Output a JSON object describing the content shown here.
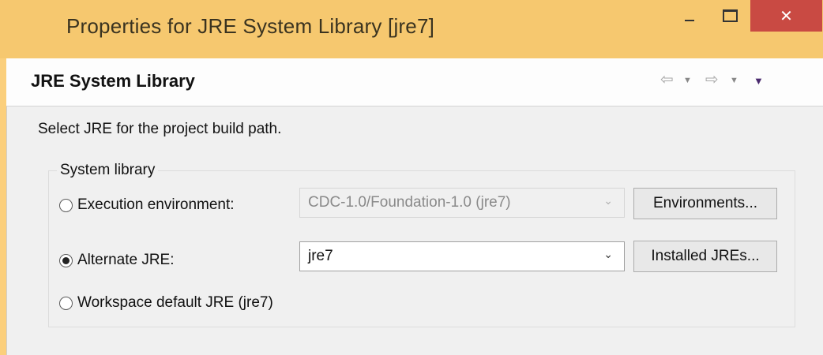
{
  "window": {
    "title": "Properties for JRE System Library [jre7]",
    "minimize_icon": "minimize-icon",
    "maximize_icon": "maximize-icon",
    "close_icon": "close-icon",
    "close_glyph": "✕"
  },
  "header": {
    "title": "JRE System Library",
    "back_glyph": "⇦",
    "forward_glyph": "⇨",
    "dropdown_glyph": "▼"
  },
  "content": {
    "description": "Select JRE for the project build path.",
    "group_label": "System library",
    "execution_environment": {
      "label": "Execution environment:",
      "selected": false,
      "combo_value": "CDC-1.0/Foundation-1.0 (jre7)",
      "combo_enabled": false,
      "button_label": "Environments..."
    },
    "alternate_jre": {
      "label": "Alternate JRE:",
      "selected": true,
      "combo_value": "jre7",
      "combo_enabled": true,
      "button_label": "Installed JREs..."
    },
    "workspace_default": {
      "label": "Workspace default JRE (jre7)",
      "selected": false
    },
    "combo_arrow": "⌄"
  },
  "colors": {
    "titlebar": "#f6c86f",
    "close_button": "#c94a43",
    "dialog_background": "#f0f0f0",
    "menu_arrow": "#4a2a6e"
  }
}
